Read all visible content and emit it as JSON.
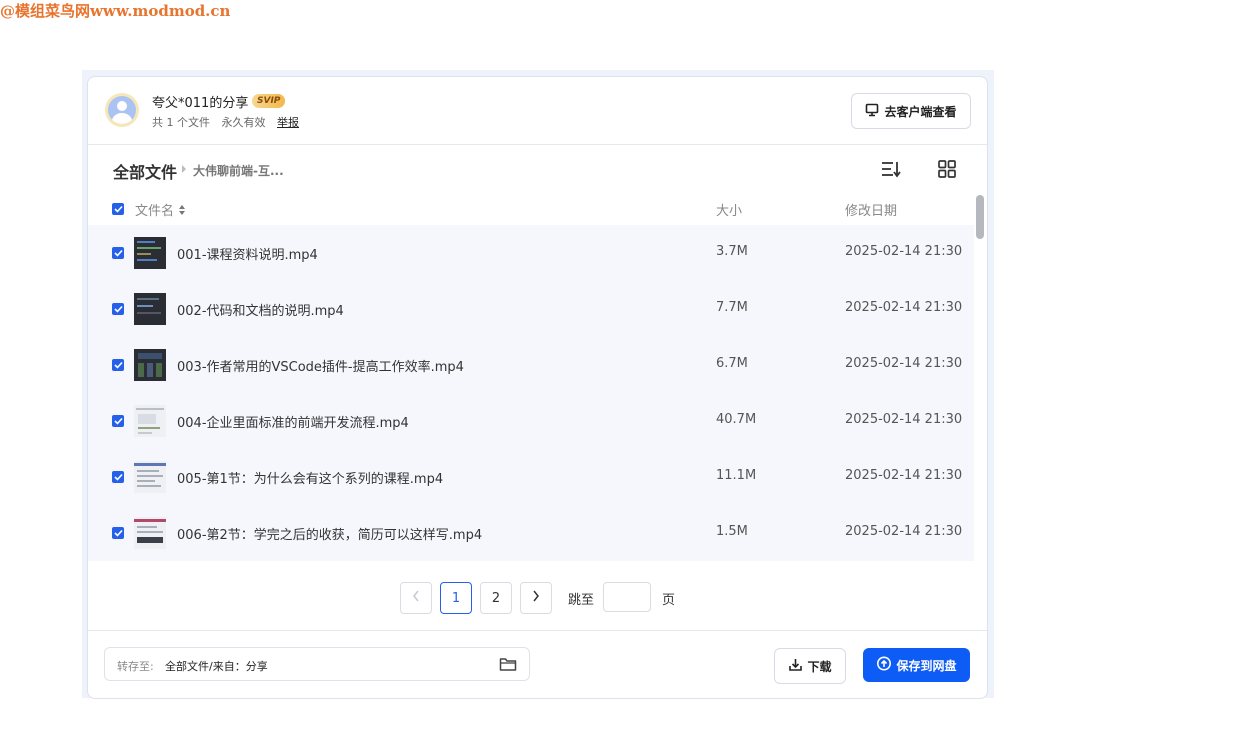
{
  "watermark": "@模组菜鸟网www.modmod.cn",
  "header": {
    "share_title": "夸父*011的分享",
    "badge": "SVIP",
    "file_count": "共 1 个文件",
    "validity": "永久有效",
    "report": "举报",
    "client_button": "去客户端查看"
  },
  "breadcrumb": {
    "root": "全部文件",
    "current": "大伟聊前端-互..."
  },
  "table": {
    "columns": {
      "name": "文件名",
      "size": "大小",
      "date": "修改日期"
    },
    "rows": [
      {
        "name": "001-课程资料说明.mp4",
        "size": "3.7M",
        "date": "2025-02-14 21:30",
        "thumb": "dark"
      },
      {
        "name": "002-代码和文档的说明.mp4",
        "size": "7.7M",
        "date": "2025-02-14 21:30",
        "thumb": "dark"
      },
      {
        "name": "003-作者常用的VSCode插件-提高工作效率.mp4",
        "size": "6.7M",
        "date": "2025-02-14 21:30",
        "thumb": "dark"
      },
      {
        "name": "004-企业里面标准的前端开发流程.mp4",
        "size": "40.7M",
        "date": "2025-02-14 21:30",
        "thumb": "light"
      },
      {
        "name": "005-第1节：为什么会有这个系列的课程.mp4",
        "size": "11.1M",
        "date": "2025-02-14 21:30",
        "thumb": "light"
      },
      {
        "name": "006-第2节：学完之后的收获，简历可以这样写.mp4",
        "size": "1.5M",
        "date": "2025-02-14 21:30",
        "thumb": "light"
      }
    ]
  },
  "pager": {
    "pages": [
      "1",
      "2"
    ],
    "current": "1",
    "jump_label": "跳至",
    "page_unit": "页"
  },
  "footer": {
    "saveto_label": "转存至:",
    "saveto_path": "全部文件/来自：分享",
    "download": "下载",
    "save": "保存到网盘"
  },
  "colors": {
    "accent": "#0e5cf6",
    "checkbox": "#2561e8",
    "row_bg": "#f5f7fc"
  }
}
